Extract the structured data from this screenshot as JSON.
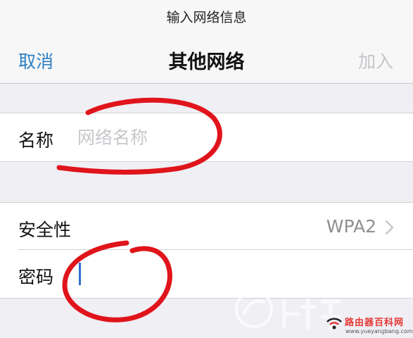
{
  "header": {
    "prompt": "输入网络信息",
    "cancel_label": "取消",
    "title": "其他网络",
    "join_label": "加入"
  },
  "form": {
    "name_label": "名称",
    "name_placeholder": "网络名称",
    "name_value": "",
    "security_label": "安全性",
    "security_value": "WPA2",
    "password_label": "密码",
    "password_value": ""
  },
  "watermark": {
    "brand": "路由器百科网",
    "url": "www.yueyangbang.com"
  },
  "colors": {
    "accent": "#2f7fc2",
    "disabled": "#c4c6ca",
    "annotation": "#e0141b",
    "background": "#efeff4"
  },
  "icons": {
    "chevron": "chevron-right-icon",
    "logo": "watermark-logo-icon"
  }
}
